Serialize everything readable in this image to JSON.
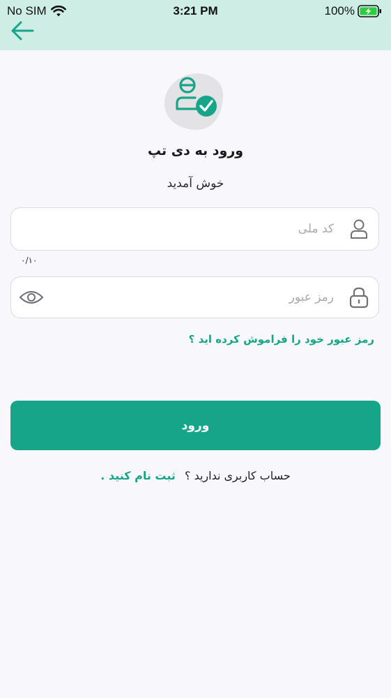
{
  "status_bar": {
    "carrier": "No SIM",
    "time": "3:21 PM",
    "battery": "100%"
  },
  "header": {
    "back_icon": "arrow-left-icon"
  },
  "brand": {
    "logo_icon": "user-check-icon",
    "title": "ورود به دی تپ",
    "subtitle": "خوش آمدید"
  },
  "form": {
    "national_code": {
      "placeholder": "کد ملی",
      "value": "",
      "counter": "۰/۱۰",
      "icon": "user-icon"
    },
    "password": {
      "placeholder": "رمز عبور",
      "value": "",
      "icon": "lock-icon",
      "toggle_icon": "eye-icon"
    },
    "forgot_label": "رمز عبور خود را فراموش کرده اید ؟",
    "submit_label": "ورود"
  },
  "register": {
    "prompt": "حساب کاربری ندارید ؟",
    "link": "ثبت نام کنید ."
  },
  "colors": {
    "accent": "#17a58a",
    "header_bg": "#cdede5",
    "page_bg": "#f8f8fc",
    "battery_green": "#2ecc40"
  }
}
